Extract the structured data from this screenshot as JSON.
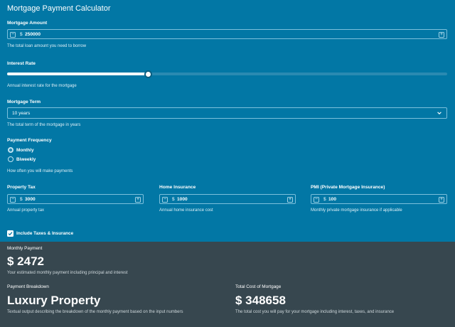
{
  "title": "Mortgage Payment Calculator",
  "currency_symbol": "$",
  "mortgage_amount": {
    "label": "Mortgage Amount",
    "value": "250000",
    "hint": "The total loan amount you need to borrow"
  },
  "interest_rate": {
    "label": "Interest Rate",
    "hint": "Annual interest rate for the mortgage",
    "slider_fraction": 0.32
  },
  "mortgage_term": {
    "label": "Mortgage Term",
    "selected": "10 years",
    "hint": "The total term of the mortgage in years"
  },
  "payment_frequency": {
    "label": "Payment Frequency",
    "options": [
      "Monthly",
      "Biweekly"
    ],
    "selected_index": 0,
    "hint": "How often you will make payments"
  },
  "property_tax": {
    "label": "Property Tax",
    "value": "3000",
    "hint": "Annual property tax"
  },
  "home_insurance": {
    "label": "Home Insurance",
    "value": "1000",
    "hint": "Annual home insurance cost"
  },
  "pmi": {
    "label": "PMI (Private Mortgage Insurance)",
    "value": "100",
    "hint": "Monthly private mortgage insurance if applicable"
  },
  "include_taxes": {
    "label": "Include Taxes & Insurance",
    "checked": true
  },
  "results": {
    "monthly_label": "Monthly Payment",
    "monthly_value": "$ 2472",
    "monthly_hint": "Your estimated monthly payment including principal and interest",
    "breakdown_label": "Payment Breakdown",
    "breakdown_value": "Luxury Property",
    "breakdown_hint": "Textual output describing the breakdown of the monthly payment based on the input numbers",
    "total_label": "Total Cost of Mortgage",
    "total_value": "$ 348658",
    "total_hint": "The total cost you will pay for your mortgage including interest, taxes, and insurance"
  },
  "icons": {
    "minus": "minus-icon",
    "plus": "plus-icon",
    "chevron": "chevron-down-icon",
    "check": "checkmark-icon"
  },
  "colors": {
    "primary": "#0277a5",
    "results_bg": "#37474f"
  }
}
